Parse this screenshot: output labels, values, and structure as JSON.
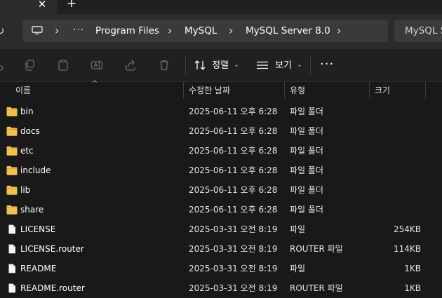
{
  "address": {
    "more_label": "···",
    "crumbs": [
      "Program Files",
      "MySQL",
      "MySQL Server 8.0"
    ],
    "search_placeholder": "MySQL S"
  },
  "toolbar": {
    "sort_label": "정렬",
    "view_label": "보기",
    "more_label": "···"
  },
  "columns": {
    "name": "이름",
    "modified": "수정한 날짜",
    "type": "유형",
    "size": "크기"
  },
  "files": [
    {
      "name": "bin",
      "modified": "2025-06-11 오후 6:28",
      "type": "파일 폴더",
      "size": "",
      "icon": "folder-icon"
    },
    {
      "name": "docs",
      "modified": "2025-06-11 오후 6:28",
      "type": "파일 폴더",
      "size": "",
      "icon": "folder-icon"
    },
    {
      "name": "etc",
      "modified": "2025-06-11 오후 6:28",
      "type": "파일 폴더",
      "size": "",
      "icon": "folder-icon"
    },
    {
      "name": "include",
      "modified": "2025-06-11 오후 6:28",
      "type": "파일 폴더",
      "size": "",
      "icon": "folder-icon"
    },
    {
      "name": "lib",
      "modified": "2025-06-11 오후 6:28",
      "type": "파일 폴더",
      "size": "",
      "icon": "folder-icon"
    },
    {
      "name": "share",
      "modified": "2025-06-11 오후 6:28",
      "type": "파일 폴더",
      "size": "",
      "icon": "folder-icon"
    },
    {
      "name": "LICENSE",
      "modified": "2025-03-31 오전 8:19",
      "type": "파일",
      "size": "254KB",
      "icon": "file-icon"
    },
    {
      "name": "LICENSE.router",
      "modified": "2025-03-31 오전 8:19",
      "type": "ROUTER 파일",
      "size": "114KB",
      "icon": "file-icon"
    },
    {
      "name": "README",
      "modified": "2025-03-31 오전 8:19",
      "type": "파일",
      "size": "1KB",
      "icon": "file-icon"
    },
    {
      "name": "README.router",
      "modified": "2025-03-31 오전 8:19",
      "type": "ROUTER 파일",
      "size": "1KB",
      "icon": "file-icon"
    }
  ],
  "colors": {
    "folder": "#f2c14e",
    "background": "#191919",
    "address_bar": "#3a3a3a"
  }
}
